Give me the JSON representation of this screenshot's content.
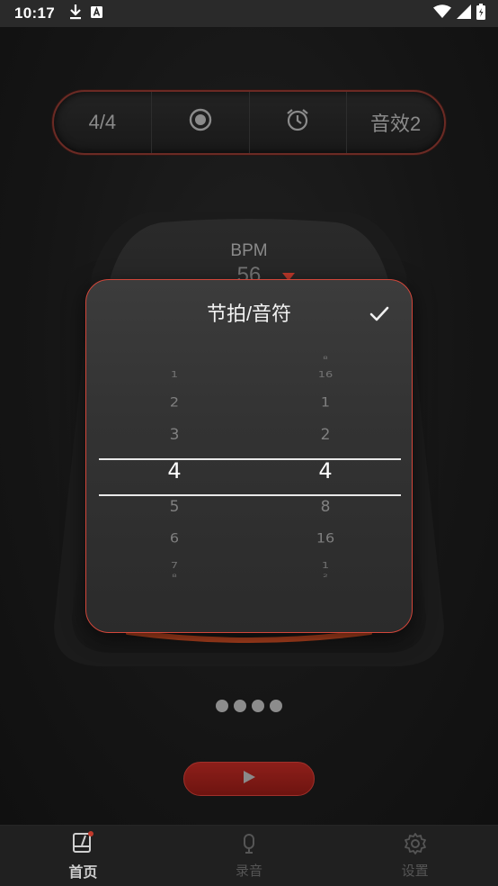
{
  "status_bar": {
    "time": "10:17",
    "left_icons": [
      "download-icon",
      "a-badge-icon"
    ],
    "right_icons": [
      "wifi-icon",
      "signal-icon",
      "battery-icon"
    ]
  },
  "control_pill": {
    "time_signature": "4/4",
    "record_icon": "radio-dot-icon",
    "alarm_icon": "alarm-clock-icon",
    "sound": "音效2"
  },
  "metronome": {
    "bpm_label": "BPM",
    "bpm_value": "56"
  },
  "dialog": {
    "title": "节拍/音符",
    "confirm_icon": "check-icon",
    "beats_column": {
      "items": [
        "1",
        "2",
        "3",
        "4",
        "5",
        "6",
        "7",
        "8"
      ],
      "selected": "4"
    },
    "note_column": {
      "items": [
        "8",
        "16",
        "1",
        "2",
        "4",
        "8",
        "16",
        "1",
        "2"
      ],
      "selected": "4"
    }
  },
  "page_indicator": {
    "count": 4,
    "active_index": 0
  },
  "play_button": {
    "icon": "play-icon"
  },
  "bottom_nav": {
    "items": [
      {
        "label": "首页",
        "icon": "metronome-icon",
        "active": true
      },
      {
        "label": "录音",
        "icon": "microphone-icon",
        "active": false
      },
      {
        "label": "设置",
        "icon": "gear-icon",
        "active": false
      }
    ]
  },
  "colors": {
    "accent_red": "#c0392b",
    "dialog_border": "#d2463a",
    "background": "#141414"
  }
}
